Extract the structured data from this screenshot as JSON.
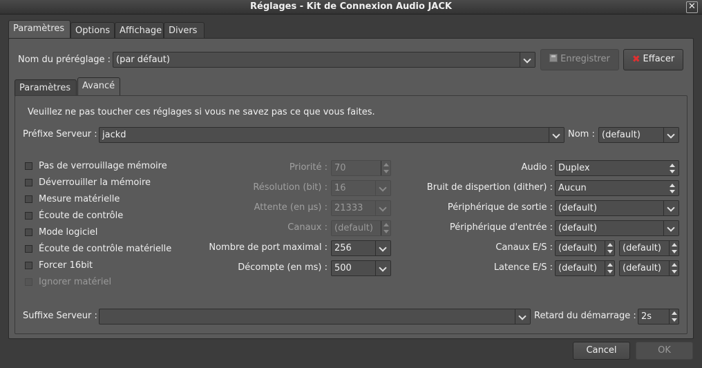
{
  "window": {
    "title": "Réglages - Kit de Connexion Audio JACK",
    "close": "✕"
  },
  "tabs": [
    "Paramètres",
    "Options",
    "Affichage",
    "Divers"
  ],
  "preset": {
    "label": "Nom du préréglage :",
    "value": "(par défaut)",
    "save_button": "Enregistrer",
    "delete_button": "Effacer"
  },
  "subtabs": [
    "Paramètres",
    "Avancé"
  ],
  "advanced": {
    "warning": "Veuillez ne pas toucher ces réglages si vous ne savez pas ce que vous faites.",
    "server_prefix_label": "Préfixe Serveur :",
    "server_prefix_value": "jackd",
    "name_label": "Nom :",
    "name_value": "(default)",
    "checkboxes": [
      {
        "label": "Pas de verrouillage mémoire",
        "checked": false,
        "enabled": true
      },
      {
        "label": "Déverrouiller la mémoire",
        "checked": false,
        "enabled": true
      },
      {
        "label": "Mesure matérielle",
        "checked": false,
        "enabled": true
      },
      {
        "label": "Écoute de contrôle",
        "checked": false,
        "enabled": true
      },
      {
        "label": "Mode logiciel",
        "checked": false,
        "enabled": true
      },
      {
        "label": "Écoute de contrôle matérielle",
        "checked": false,
        "enabled": true
      },
      {
        "label": "Forcer 16bit",
        "checked": false,
        "enabled": true
      },
      {
        "label": "Ignorer matériel",
        "checked": false,
        "enabled": false
      }
    ],
    "priority_label": "Priorité :",
    "priority_value": "70",
    "resolution_label": "Résolution (bit) :",
    "resolution_value": "16",
    "wait_label": "Attente (en µs) :",
    "wait_value": "21333",
    "channels_label": "Canaux :",
    "channels_value": "(default)",
    "max_ports_label": "Nombre de port maximal :",
    "max_ports_value": "256",
    "timeout_label": "Décompte (en ms) :",
    "timeout_value": "500",
    "audio_label": "Audio :",
    "audio_value": "Duplex",
    "dither_label": "Bruit de dispertion (dither) :",
    "dither_value": "Aucun",
    "output_device_label": "Périphérique de sortie :",
    "output_device_value": "(default)",
    "input_device_label": "Périphérique d'entrée :",
    "input_device_value": "(default)",
    "io_channels_label": "Canaux E/S :",
    "io_channels_in": "(default)",
    "io_channels_out": "(default)",
    "io_latency_label": "Latence E/S :",
    "io_latency_in": "(default)",
    "io_latency_out": "(default)",
    "server_suffix_label": "Suffixe Serveur :",
    "server_suffix_value": "",
    "startup_delay_label": "Retard du démarrage :",
    "startup_delay_value": "2s"
  },
  "footer": {
    "cancel": "Cancel",
    "ok": "OK"
  }
}
